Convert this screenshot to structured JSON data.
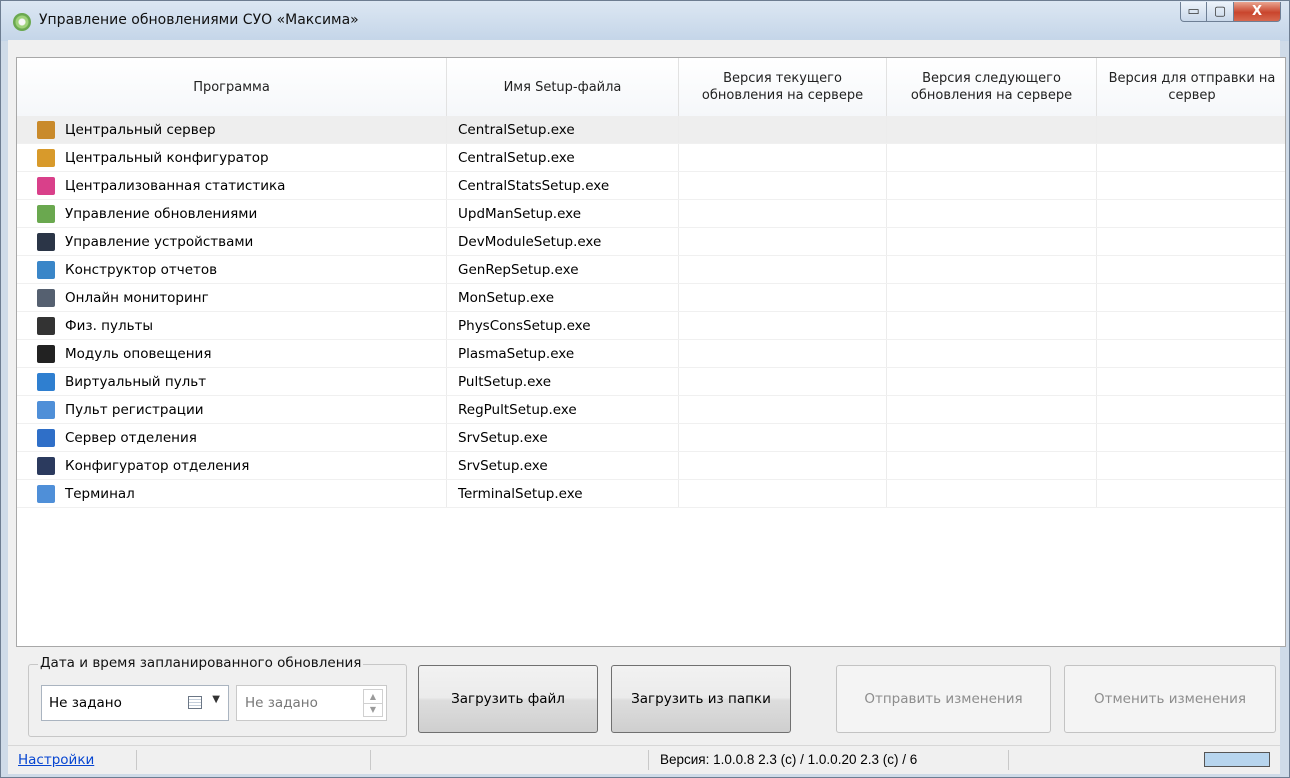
{
  "window": {
    "title": "Управление обновлениями СУО «Максима»",
    "minimize_glyph": "▭",
    "maximize_glyph": "▢",
    "close_glyph": "X"
  },
  "table": {
    "columns": [
      "Программа",
      "Имя Setup-файла",
      "Версия текущего обновления на сервере",
      "Версия следующего обновления на сервере",
      "Версия для отправки на сервер"
    ],
    "rows": [
      {
        "program": "Центральный сервер",
        "file": "CentralSetup.exe",
        "icon": "central-server-icon",
        "color": "#c98a2b",
        "selected": true
      },
      {
        "program": "Центральный конфигуратор",
        "file": "CentralSetup.exe",
        "icon": "central-configurator-icon",
        "color": "#d89a2b"
      },
      {
        "program": "Централизованная статистика",
        "file": "CentralStatsSetup.exe",
        "icon": "statistics-icon",
        "color": "#d9408a"
      },
      {
        "program": "Управление обновлениями",
        "file": "UpdManSetup.exe",
        "icon": "update-manager-icon",
        "color": "#6aa84f"
      },
      {
        "program": "Управление устройствами",
        "file": "DevModuleSetup.exe",
        "icon": "device-manager-icon",
        "color": "#2b3547"
      },
      {
        "program": "Конструктор отчетов",
        "file": "GenRepSetup.exe",
        "icon": "report-builder-icon",
        "color": "#3a86c8"
      },
      {
        "program": "Онлайн мониторинг",
        "file": "MonSetup.exe",
        "icon": "monitoring-icon",
        "color": "#556070"
      },
      {
        "program": "Физ. пульты",
        "file": "PhysConsSetup.exe",
        "icon": "calculator-icon",
        "color": "#333333"
      },
      {
        "program": "Модуль оповещения",
        "file": "PlasmaSetup.exe",
        "icon": "plasma-panel-icon",
        "color": "#222222"
      },
      {
        "program": "Виртуальный пульт",
        "file": "PultSetup.exe",
        "icon": "virtual-console-icon",
        "color": "#2f7fd0"
      },
      {
        "program": "Пульт регистрации",
        "file": "RegPultSetup.exe",
        "icon": "registration-console-icon",
        "color": "#4f8fd8"
      },
      {
        "program": "Сервер отделения",
        "file": "SrvSetup.exe",
        "icon": "branch-server-icon",
        "color": "#2f6fc8"
      },
      {
        "program": "Конфигуратор отделения",
        "file": "SrvSetup.exe",
        "icon": "branch-configurator-icon",
        "color": "#2b3a5e"
      },
      {
        "program": "Терминал",
        "file": "TerminalSetup.exe",
        "icon": "terminal-icon",
        "color": "#4f8fd8"
      }
    ]
  },
  "schedule": {
    "group_label": "Дата и время запланированного обновления",
    "date_value": "Не задано",
    "time_value": "Не задано"
  },
  "buttons": {
    "upload_file": "Загрузить файл",
    "upload_folder": "Загрузить из папки",
    "send_changes": "Отправить изменения",
    "cancel_changes": "Отменить изменения"
  },
  "status": {
    "settings_link": "Настройки",
    "version": "Версия: 1.0.0.8 2.3 (c) / 1.0.0.20 2.3 (c) / 6"
  }
}
